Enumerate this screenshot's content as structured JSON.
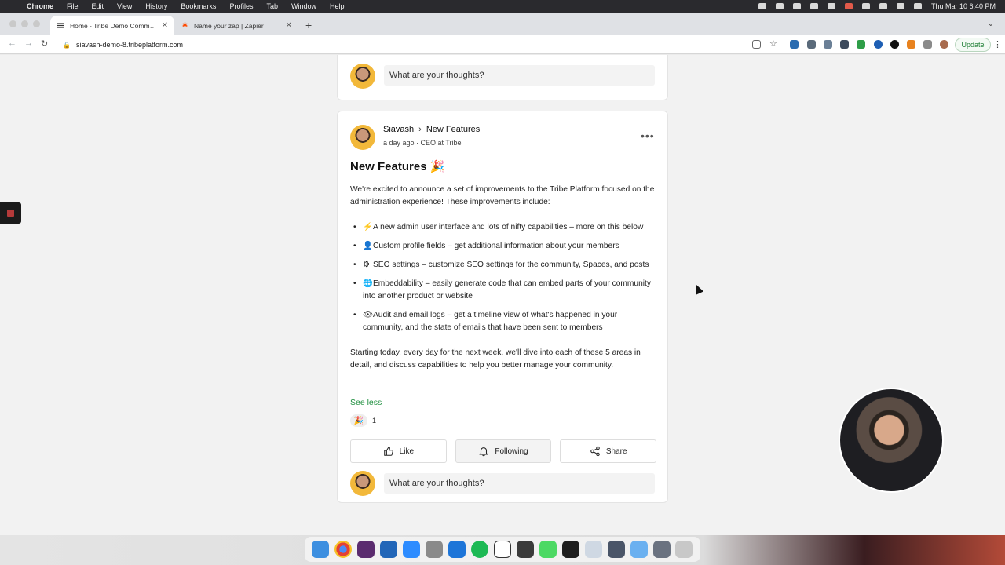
{
  "menubar": {
    "app": "Chrome",
    "items": [
      "File",
      "Edit",
      "View",
      "History",
      "Bookmarks",
      "Profiles",
      "Tab",
      "Window",
      "Help"
    ],
    "clock": "Thu Mar 10  6:40 PM"
  },
  "browser": {
    "tabs": [
      {
        "title": "Home - Tribe Demo Communit",
        "favicon": "tribe-icon"
      },
      {
        "title": "Name your zap | Zapier",
        "favicon": "zapier-icon"
      }
    ],
    "url": "siavash-demo-8.tribeplatform.com",
    "update_label": "Update"
  },
  "top_comment": {
    "placeholder": "What are your thoughts?"
  },
  "post": {
    "author": "Siavash",
    "space": "New Features",
    "meta": "a day ago · CEO at Tribe",
    "title": "New Features",
    "title_emoji": "🎉",
    "intro": "We're excited to announce a set of improvements to the Tribe Platform focused on the administration experience! These improvements include:",
    "bullets": [
      {
        "emoji": "⚡",
        "text": "A new admin user interface and lots of nifty capabilities – more on this below"
      },
      {
        "emoji": "👤",
        "text": "Custom profile fields – get additional information about your members"
      },
      {
        "emoji": "⚙",
        "text": "SEO settings – customize SEO settings for the community, Spaces, and posts"
      },
      {
        "emoji": "🌐",
        "text": "Embeddability – easily generate code that can embed parts of your community into another product or website"
      },
      {
        "emoji": "👁",
        "text": "Audit and email logs – get a timeline view of what's happened in your community, and the state of emails that have been sent to members"
      }
    ],
    "closing": "Starting today, every day for the next week, we'll dive into each of these 5 areas in detail, and discuss capabilities to help you better manage your community.",
    "see_less": "See less",
    "reaction_emoji": "🎉",
    "reaction_count": "1",
    "actions": {
      "like": "Like",
      "following": "Following",
      "share": "Share"
    },
    "comment_placeholder": "What are your thoughts?"
  }
}
